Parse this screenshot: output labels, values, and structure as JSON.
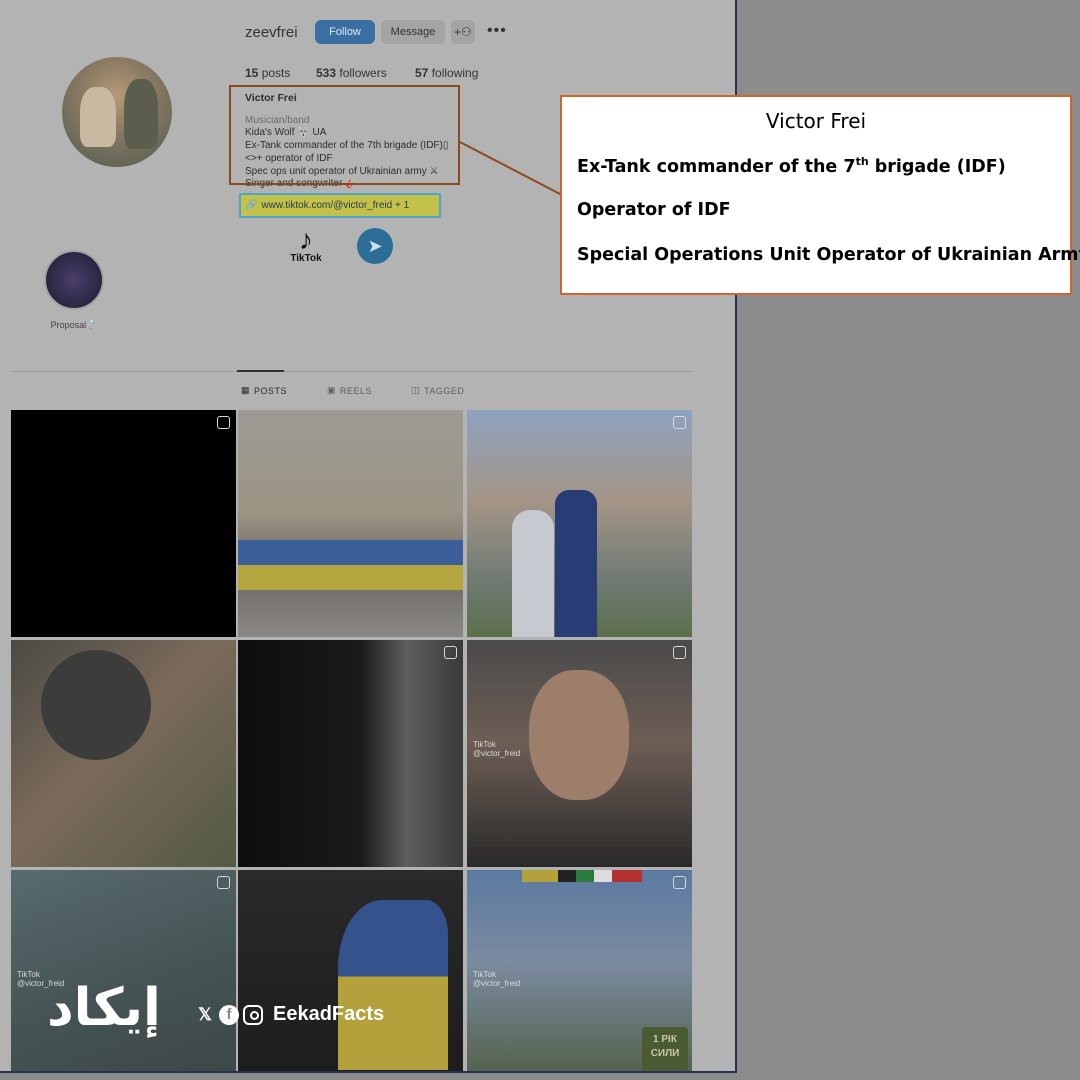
{
  "profile": {
    "username": "zeevfrei",
    "follow_label": "Follow",
    "message_label": "Message",
    "add_user_icon": "add-person-icon",
    "more_label": "•••",
    "stats": {
      "posts_num": "15",
      "posts_label": "posts",
      "followers_num": "533",
      "followers_label": "followers",
      "following_num": "57",
      "following_label": "following"
    },
    "bio": {
      "name": "Victor Frei",
      "category": "Musician/band",
      "lines": [
        "Kida's Wolf 🐺 UA",
        "Ex-Tank commander of the 7th brigade (IDF)▯",
        "<>+ operator of IDF",
        "Spec ops unit operator of Ukrainian army ⚔",
        "Singer and songwriter 🎸"
      ],
      "link": "www.tiktok.com/@victor_freid + 1"
    },
    "tiktok_label": "TikTok",
    "highlight_label": "Proposal💍"
  },
  "tabs": [
    {
      "label": "POSTS",
      "icon": "grid-icon"
    },
    {
      "label": "REELS",
      "icon": "reels-icon"
    },
    {
      "label": "TAGGED",
      "icon": "tag-icon"
    }
  ],
  "grid": {
    "tiktok_watermark": "TikTok",
    "tiktok_handle": "@victor_freid",
    "patch_text_1": "1 РІК",
    "patch_text_2": "СИЛИ"
  },
  "callout": {
    "title": "Victor Frei",
    "line1_pre": "Ex-Tank commander of the 7",
    "line1_sup": "th",
    "line1_post": " brigade (IDF)",
    "line2": "Operator of IDF",
    "line3": "Special Operations Unit Operator of Ukrainian Army"
  },
  "branding": {
    "logo": "إيكاد",
    "handle": "EekadFacts"
  },
  "colors": {
    "callout_border": "#d0662b",
    "bio_box_border": "#8a4a1e",
    "link_highlight": "#c2c24a",
    "follow_button": "#3a6fa3"
  }
}
